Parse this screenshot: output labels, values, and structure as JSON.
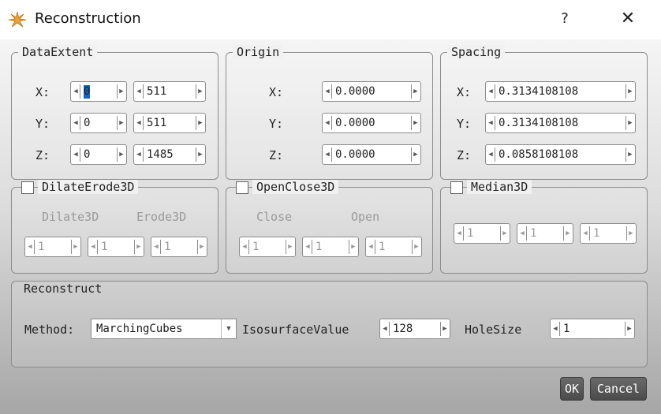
{
  "window": {
    "title": "Reconstruction",
    "help": "?",
    "close": "✕"
  },
  "data_extent": {
    "title": "DataExtent",
    "rows": [
      {
        "axis": "X:",
        "min": "0",
        "max": "511"
      },
      {
        "axis": "Y:",
        "min": "0",
        "max": "511"
      },
      {
        "axis": "Z:",
        "min": "0",
        "max": "1485"
      }
    ]
  },
  "origin": {
    "title": "Origin",
    "rows": [
      {
        "axis": "X:",
        "value": "0.0000"
      },
      {
        "axis": "Y:",
        "value": "0.0000"
      },
      {
        "axis": "Z:",
        "value": "0.0000"
      }
    ]
  },
  "spacing": {
    "title": "Spacing",
    "rows": [
      {
        "axis": "X:",
        "value": "0.3134108108"
      },
      {
        "axis": "Y:",
        "value": "0.3134108108"
      },
      {
        "axis": "Z:",
        "value": "0.0858108108"
      }
    ]
  },
  "dilate_erode": {
    "title": "DilateErode3D",
    "checked": false,
    "dilate_label": "Dilate3D",
    "erode_label": "Erode3D",
    "values": [
      "1",
      "1",
      "1"
    ]
  },
  "open_close": {
    "title": "OpenClose3D",
    "checked": false,
    "close_label": "Close",
    "open_label": "Open",
    "values": [
      "1",
      "1",
      "1"
    ]
  },
  "median": {
    "title": "Median3D",
    "checked": false,
    "values": [
      "1",
      "1",
      "1"
    ]
  },
  "reconstruct": {
    "title": "Reconstruct",
    "method_label": "Method:",
    "method_value": "MarchingCubes",
    "iso_label": "IsosurfaceValue",
    "iso_value": "128",
    "hole_label": "HoleSize",
    "hole_value": "1"
  },
  "buttons": {
    "ok": "OK",
    "cancel": "Cancel"
  },
  "colors": {
    "selection": "#1565c0",
    "button_bg": "#555555"
  }
}
